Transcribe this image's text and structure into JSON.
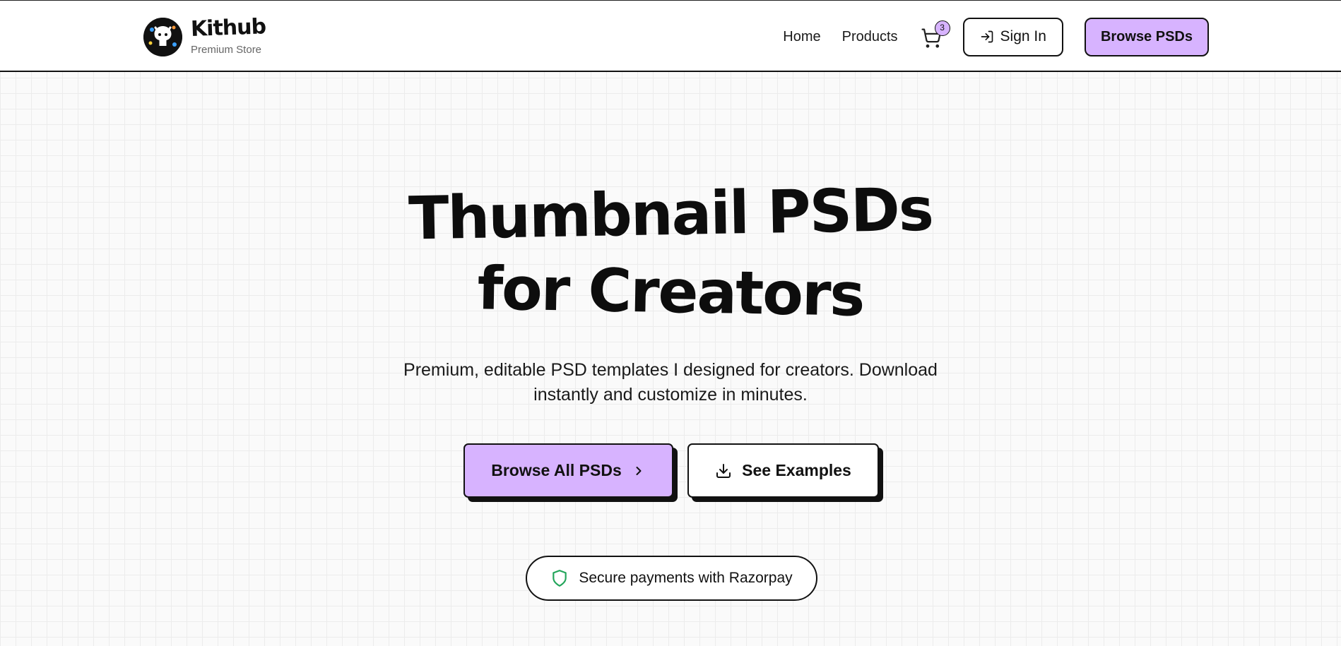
{
  "brand": {
    "name": "Kithub",
    "tagline": "Premium Store"
  },
  "nav": {
    "links": [
      "Home",
      "Products"
    ],
    "cart_count": "3",
    "sign_in_label": "Sign In",
    "browse_label": "Browse PSDs"
  },
  "hero": {
    "title_line1": "Thumbnail PSDs",
    "title_line2": "for Creators",
    "subtitle": "Premium, editable PSD templates I designed for creators. Download instantly and customize in minutes.",
    "primary_cta": "Browse All PSDs",
    "secondary_cta": "See Examples",
    "secure_text": "Secure payments with Razorpay"
  },
  "colors": {
    "accent": "#d7b3ff",
    "secure_icon": "#22a55a",
    "border": "#111111"
  },
  "icons": {
    "cart": "cart-icon",
    "sign_in": "login-icon",
    "primary_cta": "chevron-right-icon",
    "secondary_cta": "download-icon",
    "secure": "shield-icon"
  }
}
